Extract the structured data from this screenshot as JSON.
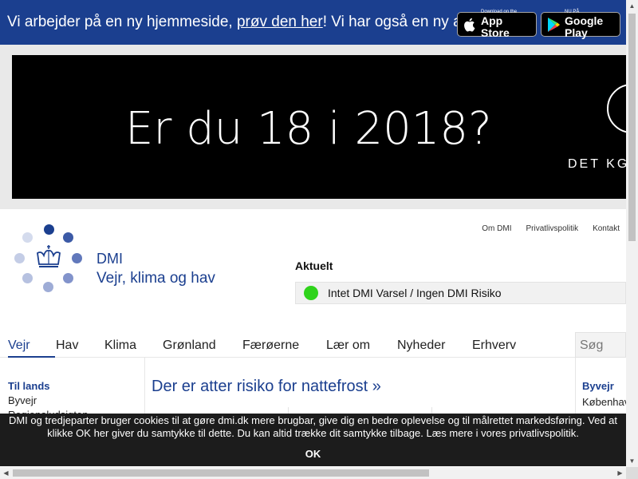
{
  "banner": {
    "text_before": "Vi arbejder på en ny hjemmeside, ",
    "link": "prøv den her",
    "text_after": "! Vi har også en ny app",
    "apple_small": "Download on the",
    "apple_big": "App Store",
    "google_small": "NU PÅ",
    "google_big": "Google Play",
    "color": "#1b3f8f"
  },
  "ad": {
    "headline": "Er du 18 i 2018?",
    "brand": "DET KG"
  },
  "header": {
    "logo_name": "DMI",
    "logo_tagline": "Vejr, klima og hav",
    "top_links": [
      "Om DMI",
      "Privatlivspolitik",
      "Kontakt"
    ],
    "aktuelt_label": "Aktuelt",
    "alert_text": "Intet DMI Varsel / Ingen DMI Risiko",
    "alert_color": "#2fd31b"
  },
  "nav": {
    "items": [
      "Vejr",
      "Hav",
      "Klima",
      "Grønland",
      "Færøerne",
      "Lær om",
      "Nyheder",
      "Erhverv"
    ],
    "active": "Vejr",
    "search_placeholder": "Søg"
  },
  "left_menu": {
    "heading": "Til lands",
    "links": [
      "Byvejr",
      "Regionaludsigten"
    ]
  },
  "main": {
    "headline": "Der er atter risiko for nattefrost »"
  },
  "right_menu": {
    "heading": "Byvejr",
    "links": [
      "Københav"
    ]
  },
  "cookie": {
    "text": "DMI og tredjeparter bruger cookies til at gøre dmi.dk mere brugbar, give dig en bedre oplevelse og til målrettet markedsføring. Ved at klikke OK her giver du samtykke til dette. Du kan altid trække dit samtykke tilbage. Læs mere i vores privatlivspolitik.",
    "ok_label": "OK"
  }
}
